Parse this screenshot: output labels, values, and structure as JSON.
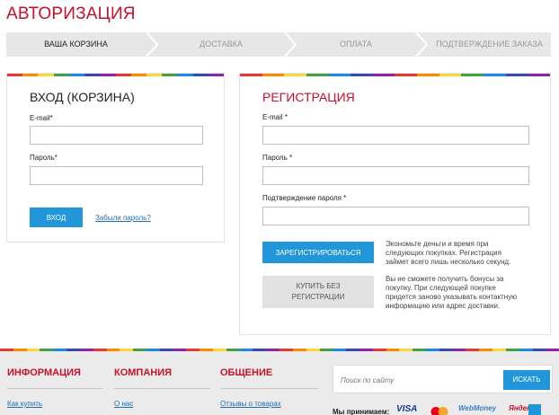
{
  "page_title": "АВТОРИЗАЦИЯ",
  "steps": [
    "ВАША КОРЗИНА",
    "ДОСТАВКА",
    "ОПЛАТА",
    "ПОДТВЕРЖДЕНИЕ ЗАКАЗА"
  ],
  "colors": {
    "accent_red": "#c9102b",
    "accent_blue": "#2196d8",
    "rainbow": [
      "#e53935",
      "#fb8c00",
      "#fdd835",
      "#43a047",
      "#1e88e5",
      "#3949ab",
      "#8e24aa",
      "#e53935",
      "#fb8c00",
      "#fdd835",
      "#43a047",
      "#1e88e5",
      "#3949ab",
      "#8e24aa"
    ]
  },
  "login": {
    "title": "ВХОД (КОРЗИНА)",
    "email_label": "E-mail*",
    "email_value": "",
    "password_label": "Пароль*",
    "password_value": "",
    "submit_label": "ВХОД",
    "forgot_label": "Забыли пароль?"
  },
  "register": {
    "title": "РЕГИСТРАЦИЯ",
    "email_label": "E-mail *",
    "email_value": "",
    "password_label": "Пароль *",
    "password_value": "",
    "confirm_label": "Подтверждение пароля *",
    "confirm_value": "",
    "submit_label": "ЗАРЕГИСТРИРОВАТЬСЯ",
    "submit_note": "Экономьте деньги и время при следующих покупках. Регистрация займет всего лишь несколько секунд.",
    "guest_label": "КУПИТЬ БЕЗ РЕГИСТРАЦИИ",
    "guest_note": "Вы не сможете получить бонусы за покупку. При следующей покупке придется заново указывать контактную информацию или адрес доставки."
  },
  "footer": {
    "col1_title": "ИНФОРМАЦИЯ",
    "col1_link": "Как купить",
    "col2_title": "КОМПАНИЯ",
    "col2_link": "О нас",
    "col3_title": "ОБЩЕНИЕ",
    "col3_link": "Отзывы о товарах",
    "search_placeholder": "Поиск по сайту",
    "search_button": "ИСКАТЬ",
    "payment_text": "Мы принимаем:",
    "payment_icons": [
      "VISA",
      "MasterCard",
      "WebMoney",
      "Яндекс"
    ]
  }
}
